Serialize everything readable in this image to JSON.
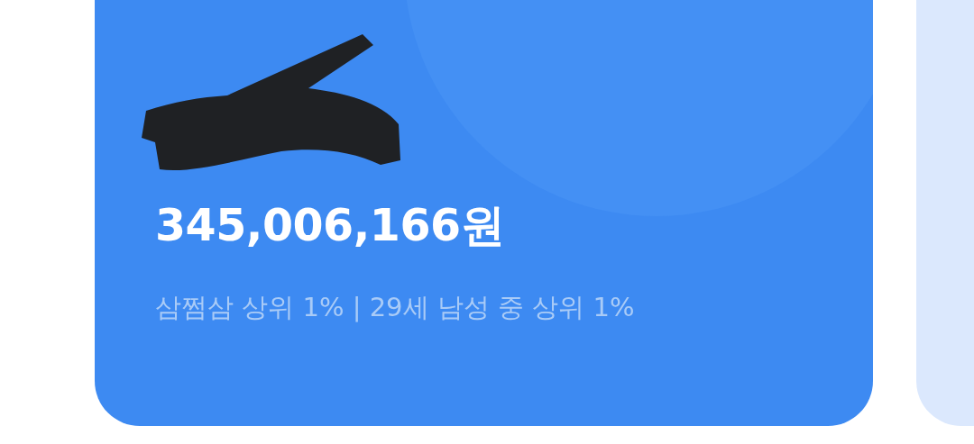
{
  "balance_card": {
    "amount": "345,006,166원",
    "ranking": "삼쩜삼 상위 1% | 29세 남성 중 상위 1%"
  }
}
